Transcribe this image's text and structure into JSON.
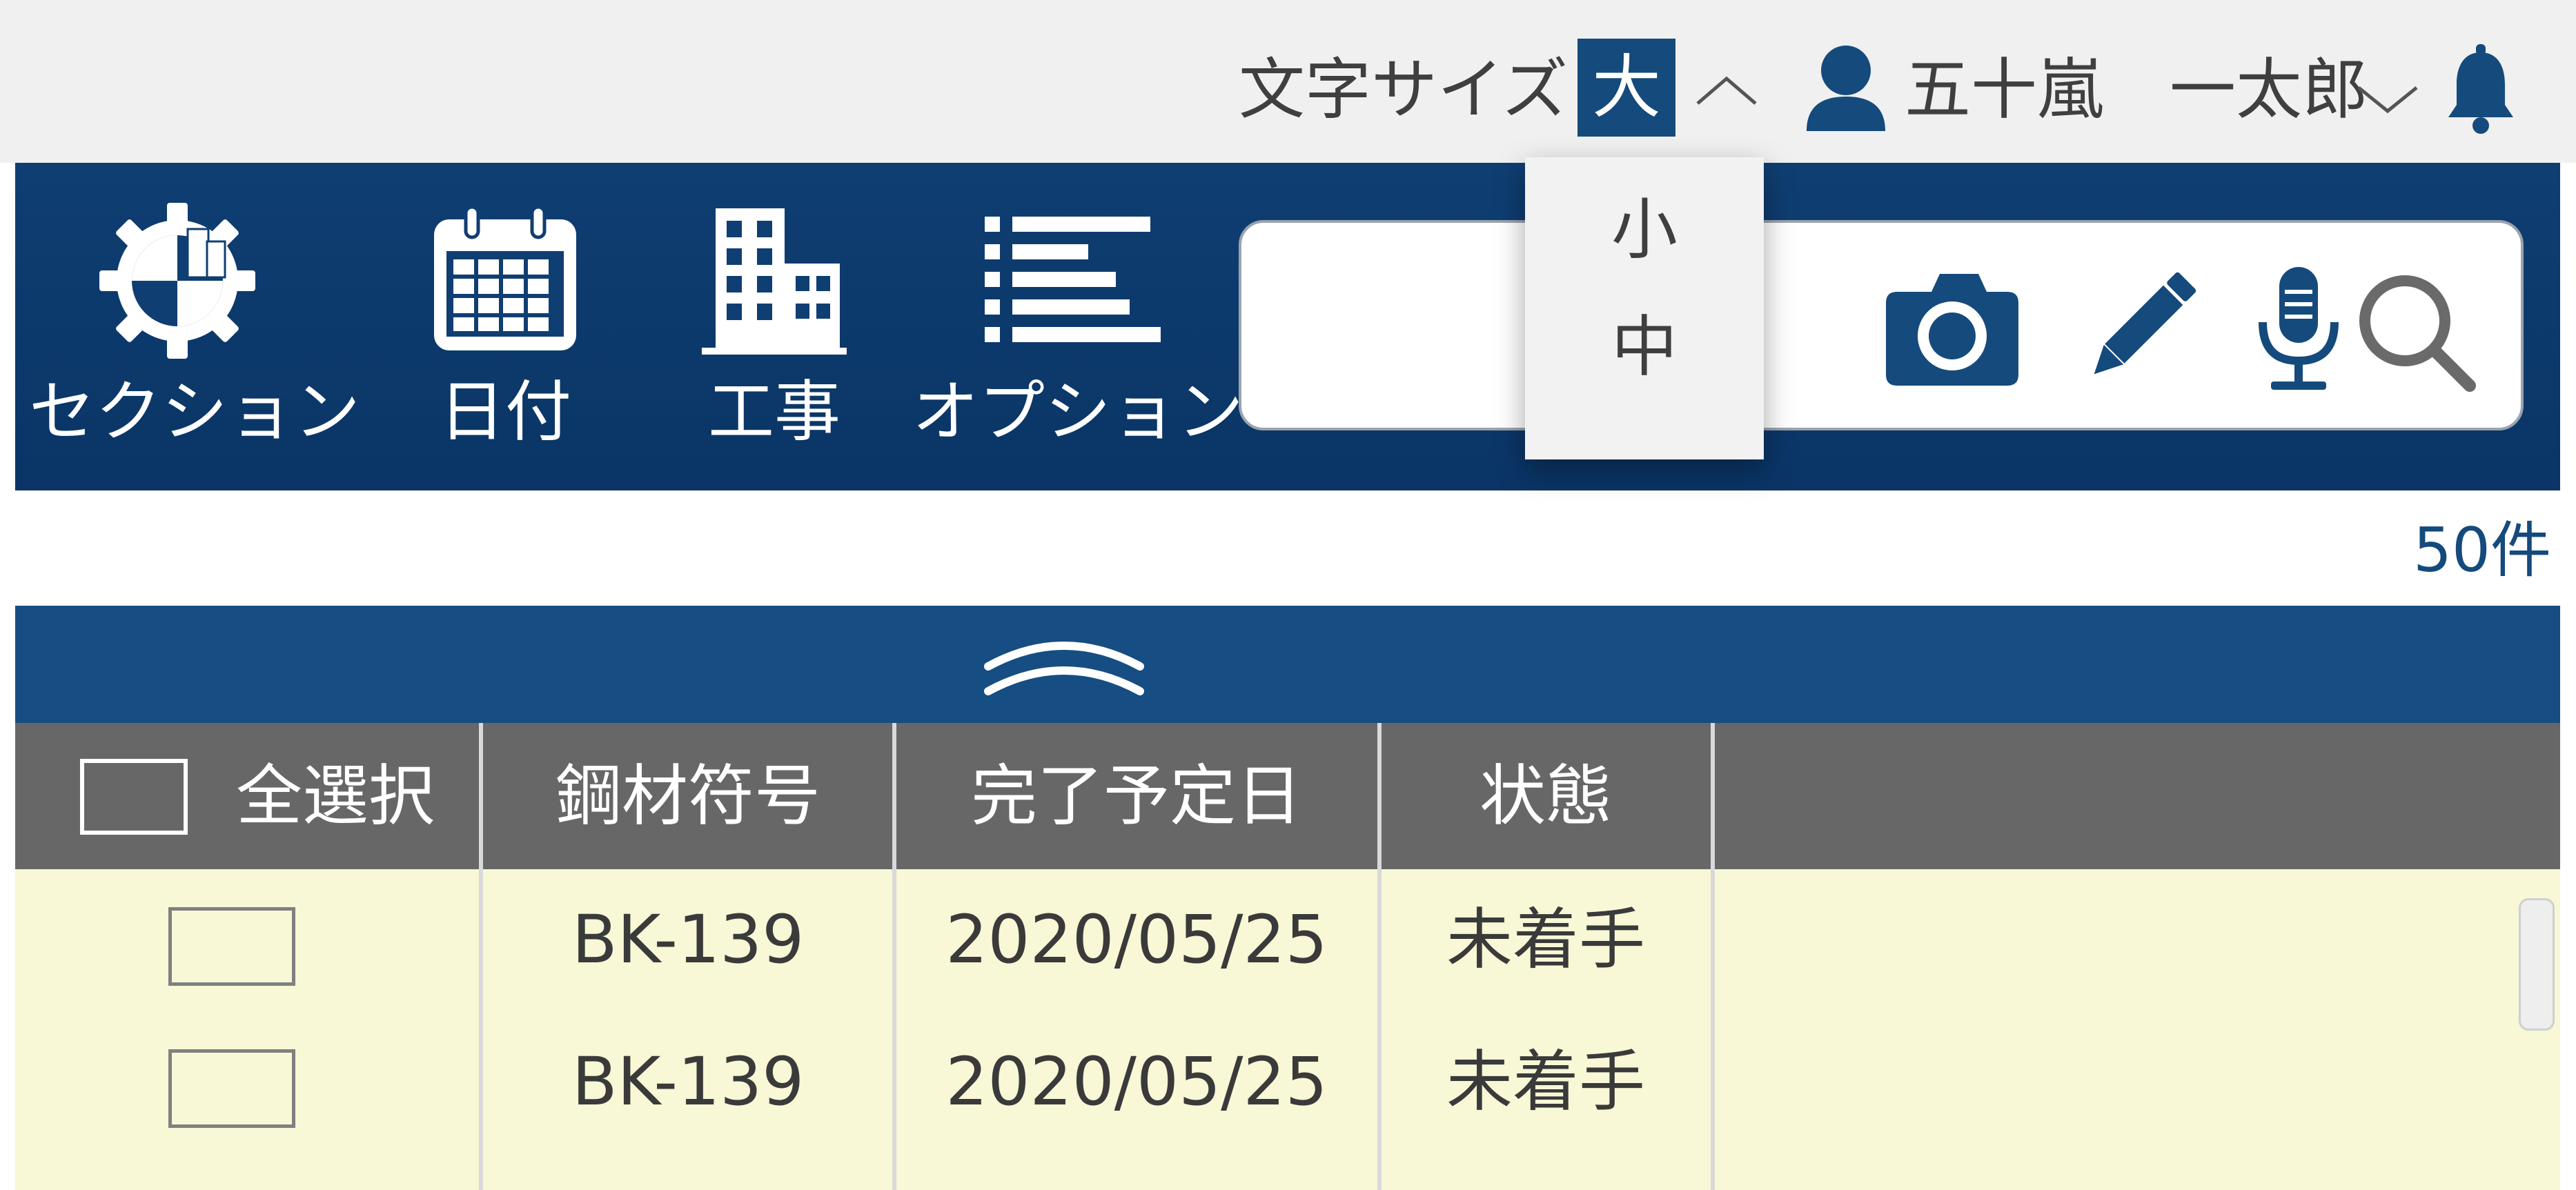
{
  "topbar": {
    "font_size_label": "文字サイズ",
    "font_size_current": "大",
    "user_name": "五十嵐　一太郎",
    "icons": [
      "chevron-up-icon",
      "user-icon",
      "chevron-down-icon",
      "bell-icon"
    ]
  },
  "font_size_dropdown": {
    "options": [
      "小",
      "中"
    ]
  },
  "nav": {
    "items": [
      {
        "label": "セクション",
        "icon": "section-gear-icon"
      },
      {
        "label": "日付",
        "icon": "calendar-icon"
      },
      {
        "label": "工事",
        "icon": "building-icon"
      },
      {
        "label": "オプション",
        "icon": "list-icon"
      }
    ]
  },
  "search": {
    "value": "",
    "placeholder": "",
    "icons": [
      "camera-icon",
      "pencil-icon",
      "microphone-icon",
      "search-icon"
    ]
  },
  "result_count": "50件",
  "table": {
    "select_all_label": "全選択",
    "columns": [
      "鋼材符号",
      "完了予定日",
      "状態"
    ],
    "rows": [
      {
        "code": "BK-139",
        "date": "2020/05/25",
        "status": "未着手",
        "checked": false
      },
      {
        "code": "BK-139",
        "date": "2020/05/25",
        "status": "未着手",
        "checked": false
      }
    ]
  },
  "colors": {
    "brand_navy": "#0d3b6e",
    "accent_blue": "#154a7c",
    "header_gray": "#676767",
    "row_bg": "#f8f7d6"
  }
}
